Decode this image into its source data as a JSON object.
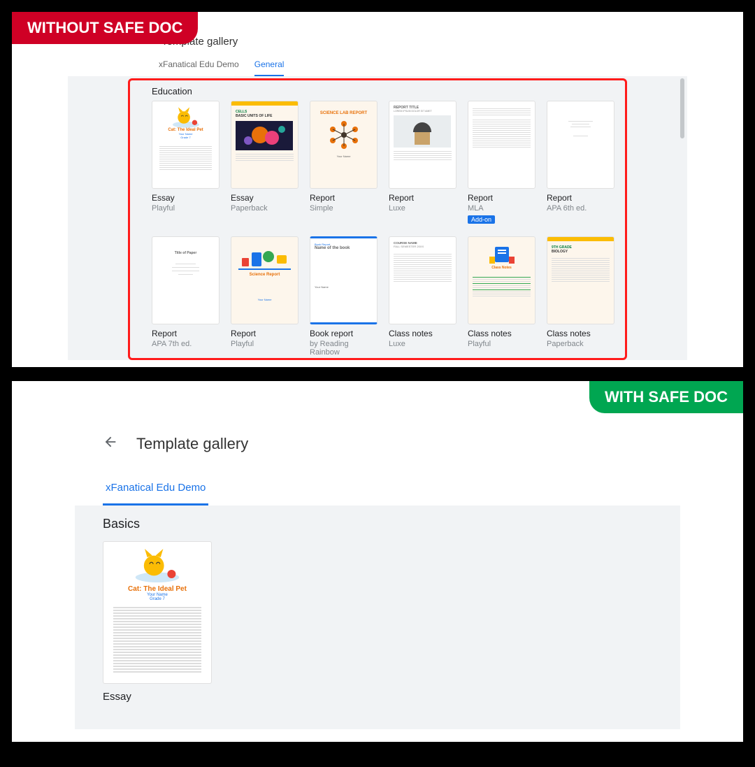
{
  "badges": {
    "without": "WITHOUT SAFE DOC",
    "with": "WITH SAFE DOC"
  },
  "top": {
    "title": "Template gallery",
    "tabs": [
      {
        "label": "xFanatical Edu Demo",
        "active": false
      },
      {
        "label": "General",
        "active": true
      }
    ],
    "section": "Education",
    "templates": [
      {
        "name": "Essay",
        "sub": "Playful",
        "thumb": "cat"
      },
      {
        "name": "Essay",
        "sub": "Paperback",
        "thumb": "cells"
      },
      {
        "name": "Report",
        "sub": "Simple",
        "thumb": "sciencelab"
      },
      {
        "name": "Report",
        "sub": "Luxe",
        "thumb": "reporttitle"
      },
      {
        "name": "Report",
        "sub": "MLA",
        "addon": "Add-on",
        "thumb": "mla"
      },
      {
        "name": "Report",
        "sub": "APA 6th ed.",
        "thumb": "apa6"
      },
      {
        "name": "Report",
        "sub": "APA 7th ed.",
        "thumb": "apa7"
      },
      {
        "name": "Report",
        "sub": "Playful",
        "thumb": "sciencereport"
      },
      {
        "name": "Book report",
        "sub": "by Reading Rainbow",
        "thumb": "bookreport"
      },
      {
        "name": "Class notes",
        "sub": "Luxe",
        "thumb": "notesluxe"
      },
      {
        "name": "Class notes",
        "sub": "Playful",
        "thumb": "notesplayful"
      },
      {
        "name": "Class notes",
        "sub": "Paperback",
        "thumb": "notespaper"
      }
    ],
    "thumb_text": {
      "cat_title": "Cat: The Ideal Pet",
      "cat_sub1": "Your Name",
      "cat_sub2": "Grade 7",
      "cells_t1": "CELLS",
      "cells_t2": "BASIC UNITS OF LIFE",
      "scilab": "SCIENCE LAB REPORT",
      "rep_t": "REPORT TITLE",
      "rep_s": "LOREM IPSUM DOLOR SIT AMET",
      "scirep": "Science Report",
      "book_l": "Book Report",
      "book_t": "Name of the book",
      "notesluxe_t1": "COURSE NAME",
      "notesluxe_t2": "FALL SEMESTER 20XX",
      "notesplay": "Class Notes",
      "notespaper_t1": "9TH GRADE",
      "notespaper_t2": "BIOLOGY"
    }
  },
  "bottom": {
    "title": "Template gallery",
    "tabs": [
      {
        "label": "xFanatical Edu Demo",
        "active": true
      }
    ],
    "section": "Basics",
    "templates": [
      {
        "name": "Essay",
        "thumb": "cat"
      }
    ],
    "thumb_text": {
      "cat_title": "Cat: The Ideal Pet",
      "cat_sub1": "Your Name",
      "cat_sub2": "Grade 7"
    }
  }
}
